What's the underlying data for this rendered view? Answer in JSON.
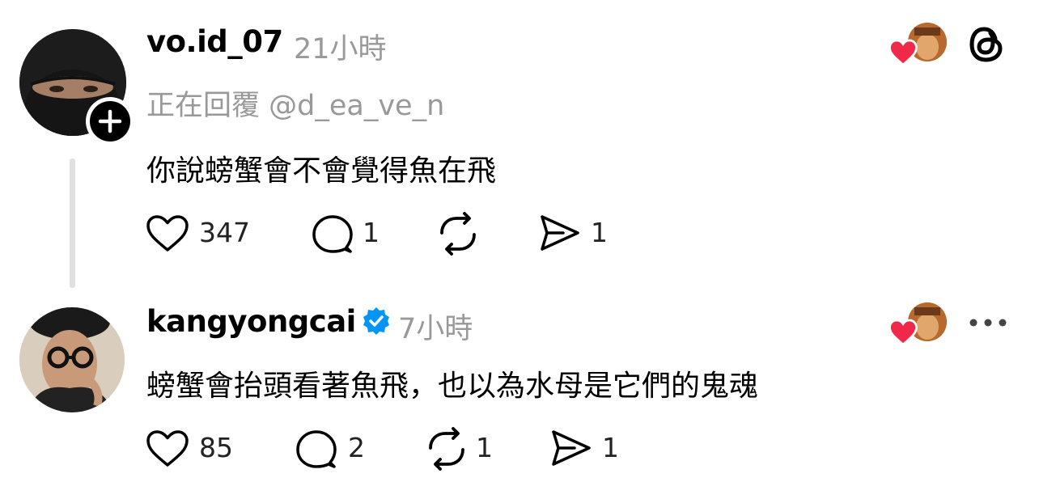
{
  "posts": [
    {
      "username": "vo.id_07",
      "time": "21小時",
      "replying_to": "正在回覆 @d_ea_ve_n",
      "text": "你說螃蟹會不會覺得魚在飛",
      "likes": "347",
      "replies": "1",
      "reposts": "",
      "shares": "1",
      "avatar_icon": "masked-person-avatar",
      "follow_icon": "plus-icon"
    },
    {
      "username": "kangyongcai",
      "verified": true,
      "time": "7小時",
      "text": "螃蟹會抬頭看著魚飛，也以為水母是它們的鬼魂",
      "likes": "85",
      "replies": "2",
      "reposts": "1",
      "shares": "1",
      "avatar_icon": "person-with-glasses-avatar"
    }
  ],
  "colors": {
    "heart_red": "#f0284a",
    "verified_blue": "#0095f6",
    "muted_gray": "#999999"
  },
  "icons": [
    "heart-icon",
    "comment-icon",
    "repost-icon",
    "share-icon",
    "threads-logo-icon",
    "more-icon",
    "liked-by-avatar"
  ]
}
